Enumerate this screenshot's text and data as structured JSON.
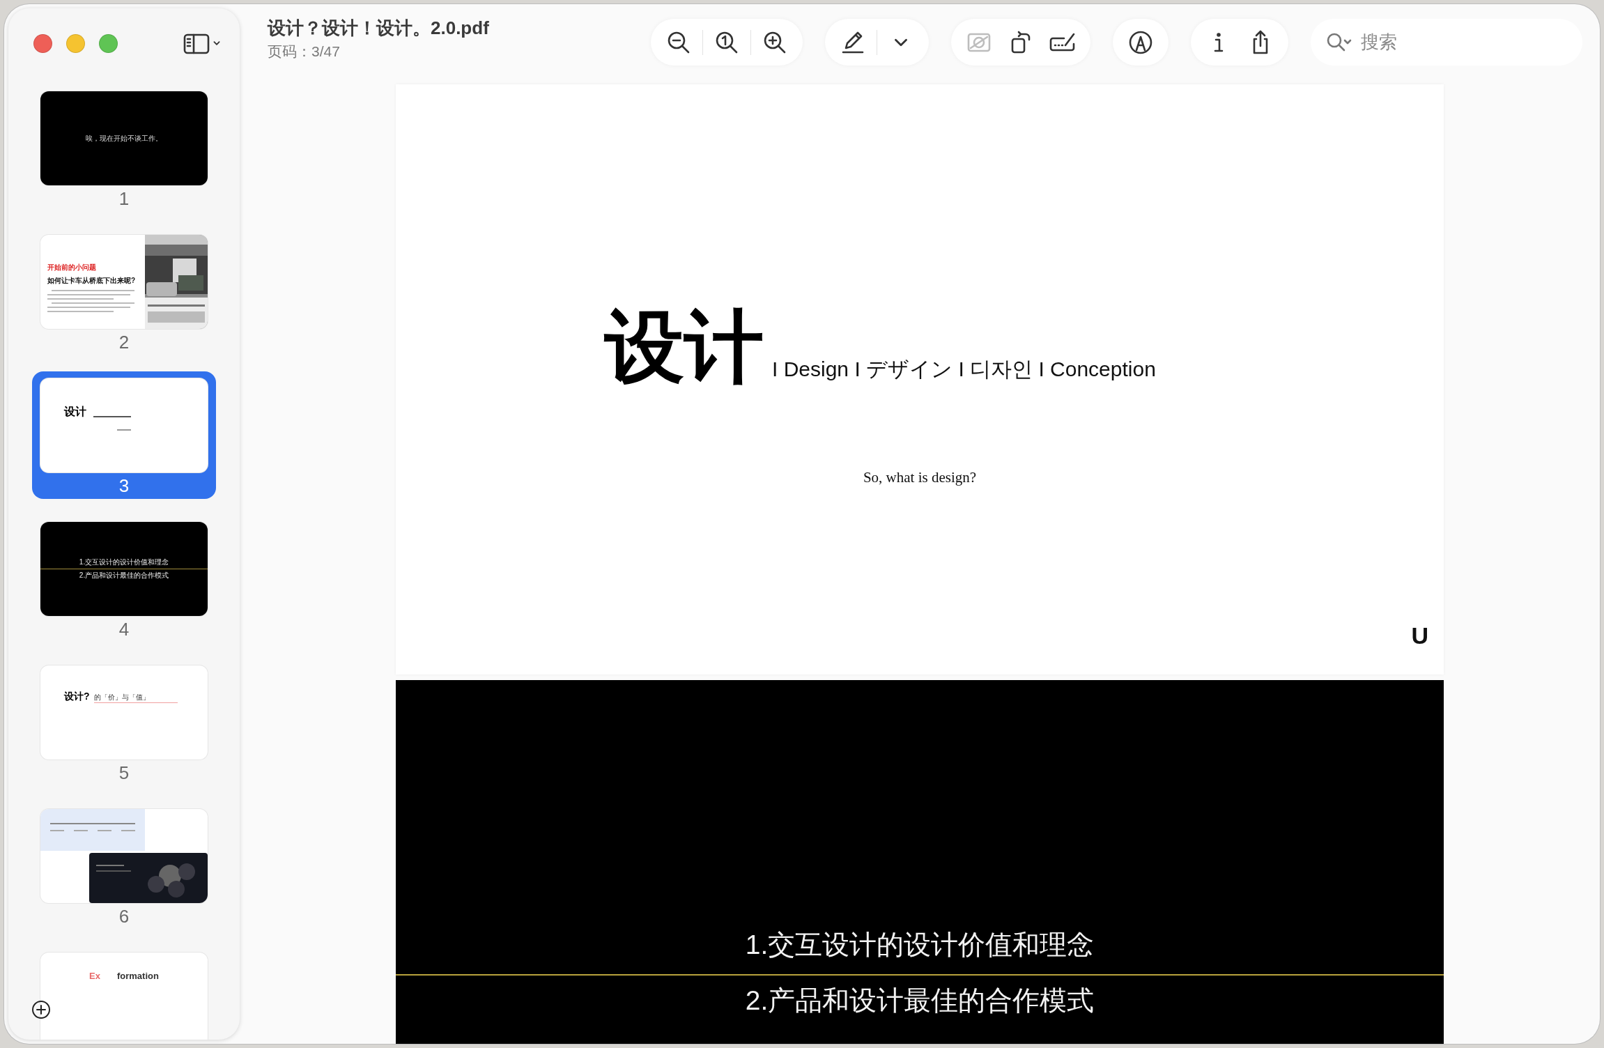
{
  "window": {
    "title": "设计？设计！设计。2.0.pdf",
    "subtitle": "页码：3/47"
  },
  "traffic_lights": [
    {
      "color": "#ee5f57"
    },
    {
      "color": "#f5c330"
    },
    {
      "color": "#5fc454"
    }
  ],
  "toolbar": {
    "groups": [
      [
        {
          "kind": "zoom_out",
          "disabled": false
        },
        {
          "kind": "actual_size",
          "disabled": false
        },
        {
          "kind": "zoom_in",
          "disabled": false
        }
      ],
      [
        {
          "kind": "highlight",
          "disabled": false
        },
        {
          "kind": "highlight_menu",
          "disabled": false
        }
      ],
      [
        {
          "kind": "crop",
          "disabled": true
        },
        {
          "kind": "rotate",
          "disabled": false
        },
        {
          "kind": "signature",
          "disabled": false
        }
      ],
      [
        {
          "kind": "markup",
          "disabled": false
        }
      ],
      [
        {
          "kind": "info",
          "disabled": false
        },
        {
          "kind": "share",
          "disabled": false
        }
      ]
    ]
  },
  "search": {
    "placeholder": "搜索"
  },
  "thumbnails": [
    {
      "kind": "dark_text",
      "label": "1",
      "selected": false,
      "text": "唉，现在开始不谈工作。"
    },
    {
      "kind": "article",
      "label": "2",
      "selected": false,
      "tag": "开始前的小问题",
      "title": "如何让卡车从桥底下出来呢?"
    },
    {
      "kind": "title_slide",
      "label": "3",
      "selected": true,
      "title": "设计"
    },
    {
      "kind": "agenda",
      "label": "4",
      "selected": false,
      "items": [
        "1.交互设计的设计价值和理念",
        "2.产品和设计最佳的合作模式"
      ]
    },
    {
      "kind": "section",
      "label": "5",
      "selected": false,
      "title": "设计?",
      "note": "的「价」与「值」"
    },
    {
      "kind": "collage",
      "label": "6",
      "selected": false
    },
    {
      "kind": "faded_title",
      "selected": false,
      "parts": [
        {
          "text": "Ex",
          "color": "#e86a6a"
        },
        {
          "text": "formation",
          "color": "#333333"
        }
      ]
    }
  ],
  "pages": [
    {
      "kind": "title_slide",
      "title": "设计",
      "subtitle": "I Design I デザイン I 디자인 I Conception",
      "question": "So, what is design?",
      "logo": "U"
    },
    {
      "kind": "agenda",
      "items": [
        "1.交互设计的设计价值和理念",
        "2.产品和设计最佳的合作模式"
      ]
    }
  ]
}
